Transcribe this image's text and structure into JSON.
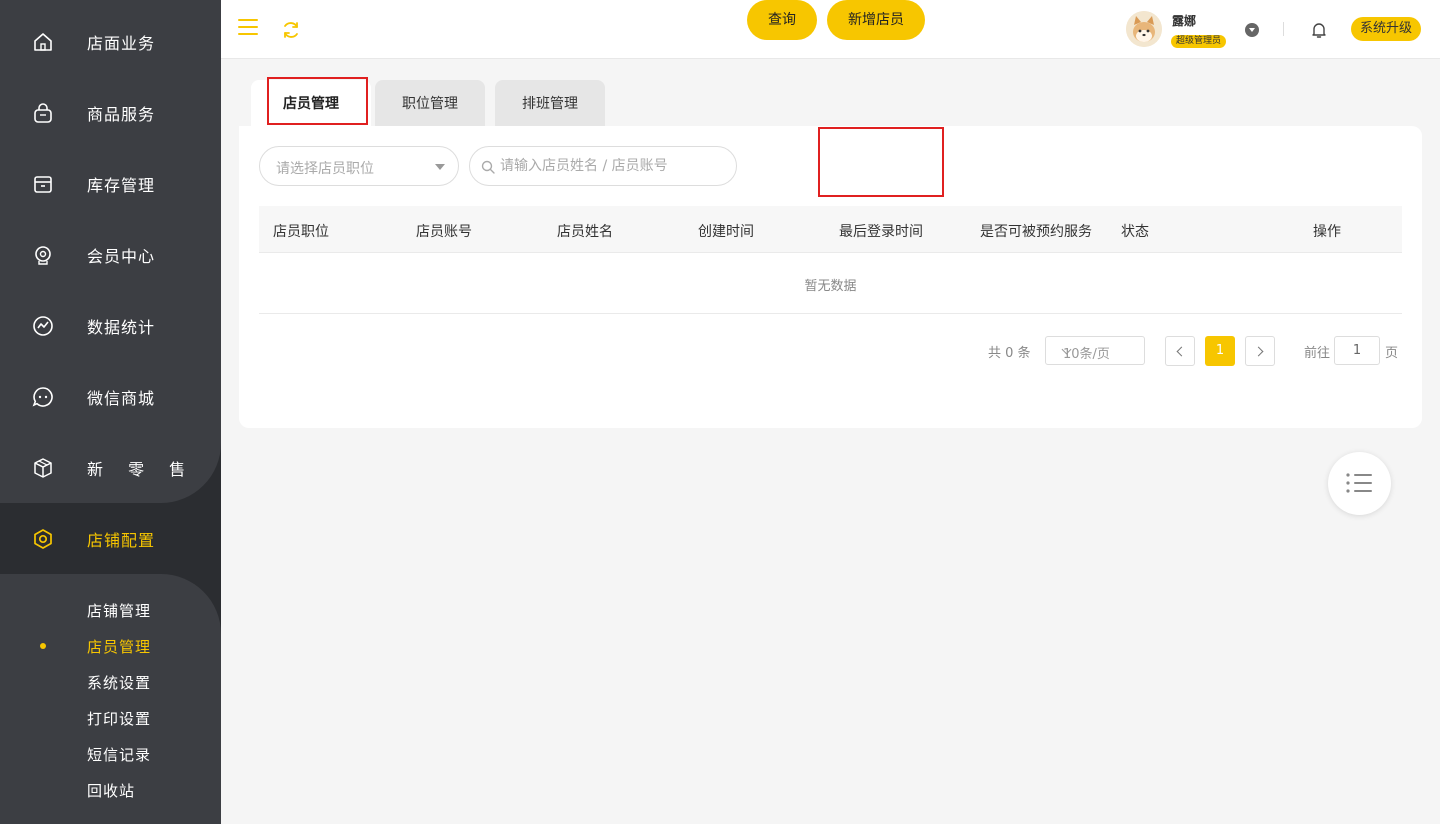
{
  "sidebar": {
    "items": [
      {
        "label": "店面业务",
        "icon": "house-icon"
      },
      {
        "label": "商品服务",
        "icon": "shopping-bag-icon"
      },
      {
        "label": "库存管理",
        "icon": "archive-box-icon"
      },
      {
        "label": "会员中心",
        "icon": "member-icon"
      },
      {
        "label": "数据统计",
        "icon": "chart-icon"
      },
      {
        "label": "微信商城",
        "icon": "chat-icon"
      },
      {
        "label": "新 零 售",
        "icon": "cube-icon"
      },
      {
        "label": "店铺配置",
        "icon": "settings-hexagon-icon",
        "active": true
      }
    ],
    "sub_items": [
      {
        "label": "店铺管理"
      },
      {
        "label": "店员管理",
        "active": true
      },
      {
        "label": "系统设置"
      },
      {
        "label": "打印设置"
      },
      {
        "label": "短信记录"
      },
      {
        "label": "回收站"
      }
    ]
  },
  "header": {
    "user_name": "露娜",
    "role": "超级管理员",
    "upgrade_label": "系统升级"
  },
  "tabs": [
    {
      "label": "店员管理",
      "active": true
    },
    {
      "label": "职位管理"
    },
    {
      "label": "排班管理"
    }
  ],
  "filters": {
    "position_placeholder": "请选择店员职位",
    "search_placeholder": "请输入店员姓名 / 店员账号",
    "query_label": "查询",
    "add_label": "新增店员"
  },
  "table": {
    "columns": [
      "店员职位",
      "店员账号",
      "店员姓名",
      "创建时间",
      "最后登录时间",
      "是否可被预约服务",
      "状态",
      "操作"
    ],
    "empty_text": "暂无数据"
  },
  "pagination": {
    "total_text": "共 0 条",
    "page_size": "10条/页",
    "current_page": "1",
    "goto_label": "前往",
    "goto_value": "1",
    "page_label": "页"
  },
  "colors": {
    "accent": "#f7c600",
    "sidebar_bg": "#3c3e43",
    "highlight_box": "#e02020"
  }
}
